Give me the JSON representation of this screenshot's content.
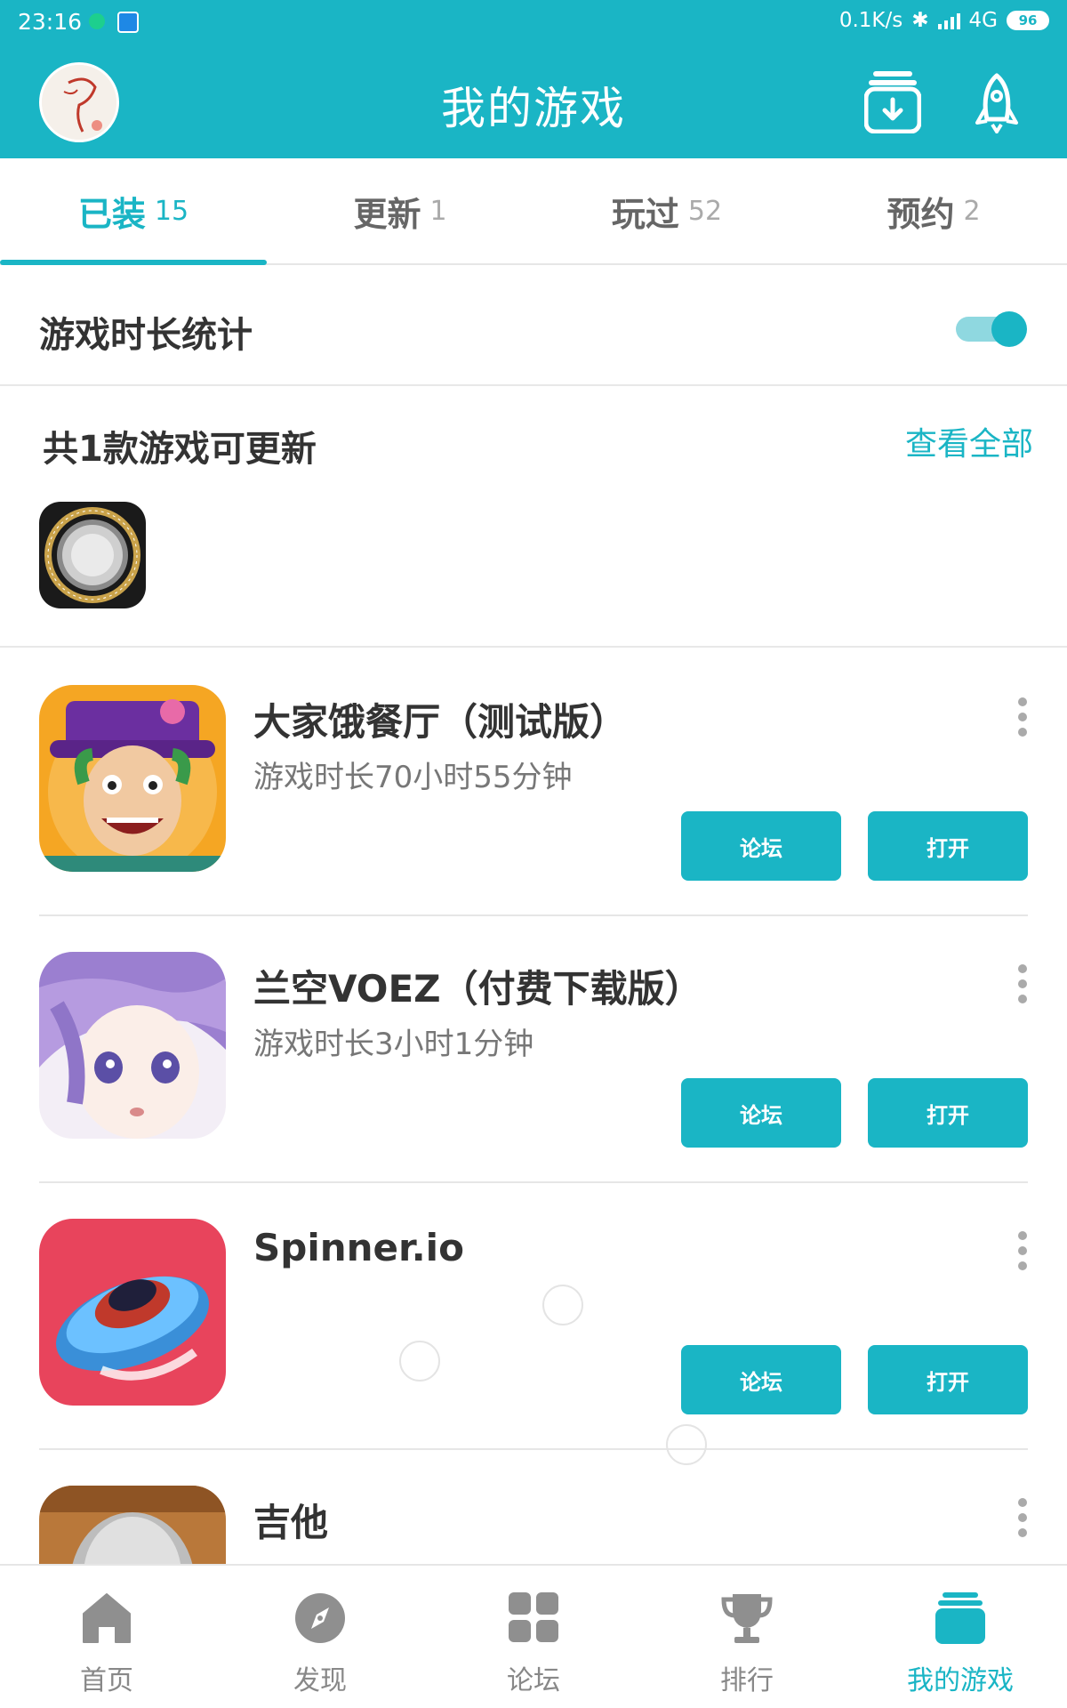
{
  "status_bar": {
    "time": "23:16",
    "network_speed": "0.1K/s",
    "network_type": "4G",
    "battery": "96"
  },
  "header": {
    "title": "我的游戏",
    "left_icon": "user-avatar",
    "right_icons": [
      "download-icon",
      "rocket-icon"
    ]
  },
  "tabs": [
    {
      "label": "已装",
      "count": "15",
      "active": true
    },
    {
      "label": "更新",
      "count": "1",
      "active": false
    },
    {
      "label": "玩过",
      "count": "52",
      "active": false
    },
    {
      "label": "预约",
      "count": "2",
      "active": false
    }
  ],
  "stats": {
    "label": "游戏时长统计",
    "enabled": true
  },
  "updates": {
    "title": "共1款游戏可更新",
    "view_all": "查看全部"
  },
  "games": [
    {
      "name": "大家饿餐厅（测试版）",
      "playtime": "游戏时长70小时55分钟",
      "forum_label": "论坛",
      "open_label": "打开"
    },
    {
      "name": "兰空VOEZ（付费下载版）",
      "playtime": "游戏时长3小时1分钟",
      "forum_label": "论坛",
      "open_label": "打开"
    },
    {
      "name": "Spinner.io",
      "playtime": "",
      "forum_label": "论坛",
      "open_label": "打开"
    },
    {
      "name": "吉他",
      "playtime": "",
      "forum_label": "",
      "open_label": ""
    }
  ],
  "bottom_nav": [
    {
      "label": "首页",
      "icon": "home-icon",
      "active": false
    },
    {
      "label": "发现",
      "icon": "compass-icon",
      "active": false
    },
    {
      "label": "论坛",
      "icon": "grid-icon",
      "active": false
    },
    {
      "label": "排行",
      "icon": "trophy-icon",
      "active": false
    },
    {
      "label": "我的游戏",
      "icon": "my-games-icon",
      "active": true
    }
  ],
  "colors": {
    "accent": "#1ab5c5",
    "header_bg": "#1ab5c5",
    "inactive_text": "#888888"
  }
}
